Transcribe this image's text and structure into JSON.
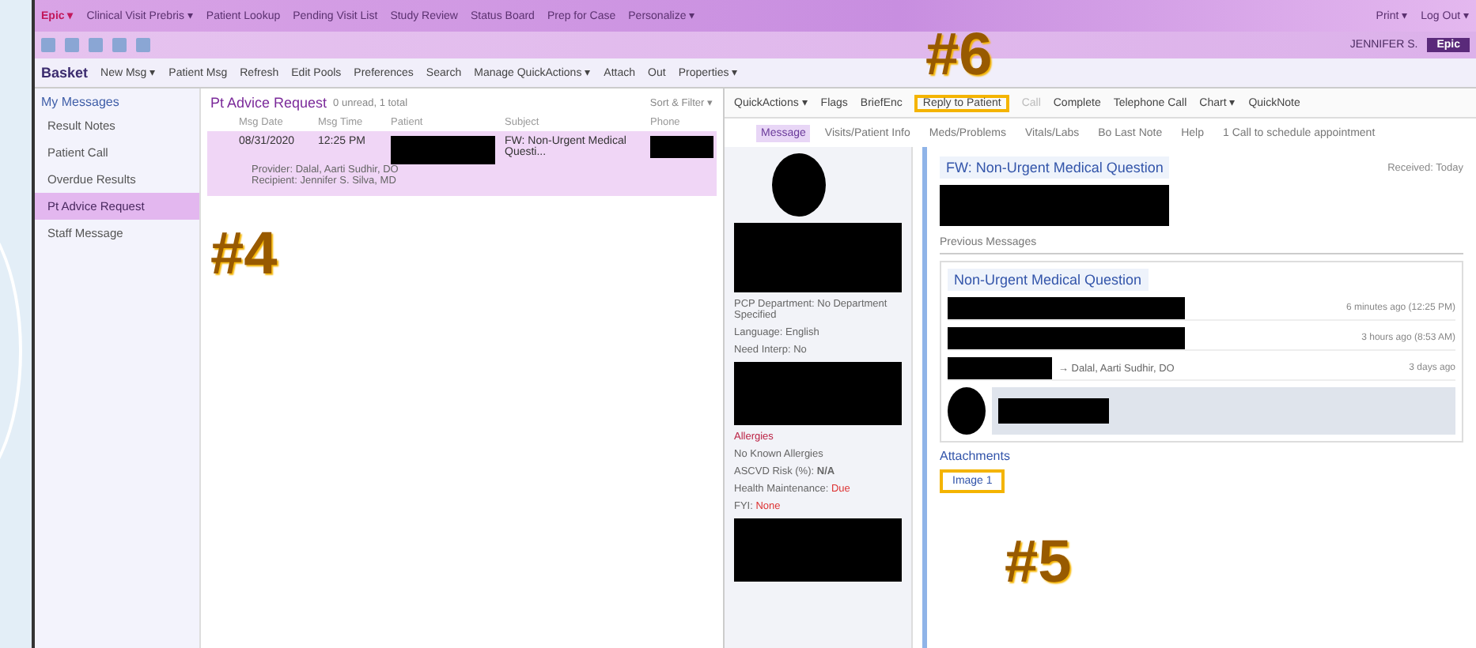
{
  "top_nav": {
    "logo": "Epic ▾",
    "items": [
      "Clinical Visit Prebris ▾",
      "Patient Lookup",
      "Pending Visit List",
      "Study Review",
      "Status Board",
      "Prep for Case",
      "Personalize ▾"
    ],
    "right": [
      "Print ▾",
      "Log Out ▾"
    ],
    "user": "JENNIFER S.",
    "badge": "Epic"
  },
  "toolbar": {
    "title": "Basket",
    "items": [
      "New Msg ▾",
      "Patient Msg",
      "Refresh",
      "Edit Pools",
      "Preferences",
      "Search",
      "Manage QuickActions ▾",
      "Attach",
      "Out",
      "Properties ▾"
    ]
  },
  "sidebar": {
    "title": "My Messages",
    "items": [
      {
        "label": "Result Notes",
        "selected": false
      },
      {
        "label": "Patient Call",
        "selected": false
      },
      {
        "label": "Overdue Results",
        "selected": false
      },
      {
        "label": "Pt Advice Request",
        "selected": true
      },
      {
        "label": "Staff Message",
        "selected": false
      }
    ]
  },
  "message_list": {
    "title": "Pt Advice Request",
    "summary": "0 unread, 1 total",
    "sort": "Sort & Filter ▾",
    "columns": [
      "Msg Date",
      "Msg Time",
      "Patient",
      "Subject",
      "Phone"
    ],
    "rows": [
      {
        "date": "08/31/2020",
        "time": "12:25 PM",
        "subject": "FW: Non-Urgent Medical Questi...",
        "provider": "Provider: Dalal, Aarti Sudhir, DO",
        "recipient": "Recipient: Jennifer S. Silva, MD",
        "selected": true
      }
    ]
  },
  "actions": [
    {
      "label": "QuickActions ▾",
      "disabled": false,
      "highlighted": false
    },
    {
      "label": "Flags",
      "disabled": false,
      "highlighted": false
    },
    {
      "label": "BriefEnc",
      "disabled": false,
      "highlighted": false
    },
    {
      "label": "Reply to Patient",
      "disabled": false,
      "highlighted": true
    },
    {
      "label": "Call",
      "disabled": true,
      "highlighted": false
    },
    {
      "label": "Complete",
      "disabled": false,
      "highlighted": false
    },
    {
      "label": "Telephone Call",
      "disabled": false,
      "highlighted": false
    },
    {
      "label": "Chart ▾",
      "disabled": false,
      "highlighted": false
    },
    {
      "label": "QuickNote",
      "disabled": false,
      "highlighted": false
    }
  ],
  "tabs": [
    {
      "label": "Message",
      "selected": true
    },
    {
      "label": "Visits/Patient Info",
      "selected": false
    },
    {
      "label": "Meds/Problems",
      "selected": false
    },
    {
      "label": "Vitals/Labs",
      "selected": false
    },
    {
      "label": "Bo Last Note",
      "selected": false
    },
    {
      "label": "Help",
      "selected": false
    },
    {
      "label": "1 Call to schedule appointment",
      "selected": false
    }
  ],
  "patient": {
    "pcp": "PCP Department: No Department Specified",
    "language": "Language: English",
    "interp": "Need Interp: No",
    "allergies_label": "Allergies",
    "allergies": "No Known Allergies",
    "ascvd_label": "ASCVD Risk (%):",
    "ascvd": "N/A",
    "hm_label": "Health Maintenance:",
    "hm": "Due",
    "fyi_label": "FYI:",
    "fyi": "None"
  },
  "message": {
    "title": "FW: Non-Urgent Medical Question",
    "received": "Received: Today",
    "previous": "Previous Messages",
    "thread_title": "Non-Urgent Medical Question",
    "thread": [
      {
        "kind": "entry",
        "time": "6 minutes ago (12:25 PM)"
      },
      {
        "kind": "entry",
        "time": "3 hours ago (8:53 AM)"
      },
      {
        "kind": "forward",
        "to": "→ Dalal, Aarti Sudhir, DO",
        "time": "3 days ago"
      },
      {
        "kind": "reply"
      }
    ],
    "attachments_title": "Attachments",
    "attachments": [
      {
        "label": "Image 1",
        "highlighted": true
      }
    ]
  },
  "annotations": [
    "#4",
    "#5",
    "#6"
  ]
}
